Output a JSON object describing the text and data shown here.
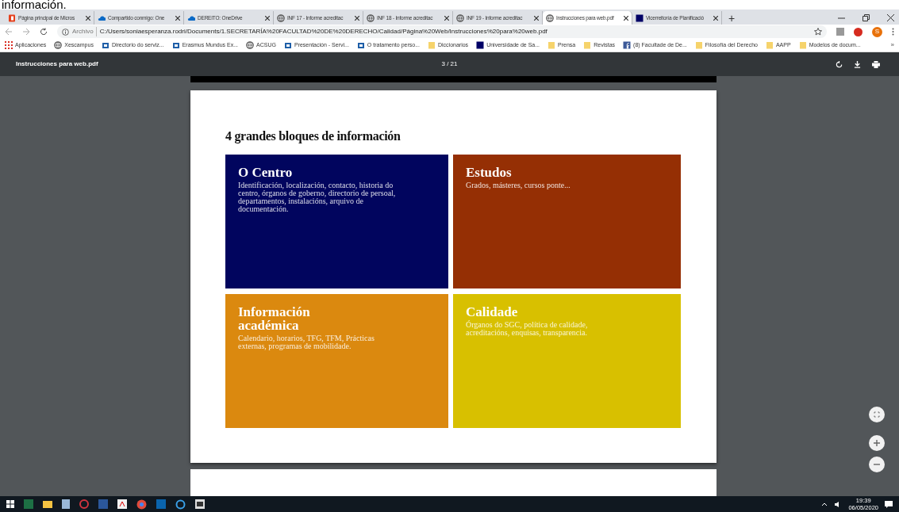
{
  "caption": "información.",
  "tabs": [
    {
      "title": "Página principal de Micros",
      "selected": false
    },
    {
      "title": "Compartido conmigo: One",
      "selected": false
    },
    {
      "title": "DEREITO: OneDrive",
      "selected": false
    },
    {
      "title": "INF 17 - Informe acreditac",
      "selected": false
    },
    {
      "title": "INF 18 - Informe acreditac",
      "selected": false
    },
    {
      "title": "INF 19 - Informe acreditac",
      "selected": false
    },
    {
      "title": "Instrucciones para web.pdf",
      "selected": true
    },
    {
      "title": "Vicerreitoría de Planificació",
      "selected": false
    }
  ],
  "new_tab": "+",
  "address": {
    "scheme": "Archivo",
    "url": "C:/Users/soniaesperanza.rodri/Documents/1.SECRETARÍA%20FACULTAD%20DE%20DERECHO/Calidad/Página%20Web/Instrucciones%20para%20web.pdf",
    "profile_initial": "S"
  },
  "bookmarks": [
    {
      "label": "Aplicaciones"
    },
    {
      "label": "Xescampus"
    },
    {
      "label": "Directorio do serviz..."
    },
    {
      "label": "Erasmus Mundus Ex..."
    },
    {
      "label": "ACSUG"
    },
    {
      "label": "Presentación - Servi..."
    },
    {
      "label": "O tratamento perso..."
    },
    {
      "label": "Diccionarios"
    },
    {
      "label": "Universidade de Sa..."
    },
    {
      "label": "Prensa"
    },
    {
      "label": "Revistas"
    },
    {
      "label": "(8) Facultade de De..."
    },
    {
      "label": "Filosofía del Derecho"
    },
    {
      "label": "AAPP"
    },
    {
      "label": "Modelos de docum..."
    }
  ],
  "bookmarks_more": "»",
  "pdf": {
    "filename": "Instrucciones para web.pdf",
    "page_indicator": "3 / 21",
    "heading": "4 grandes bloques de información",
    "blocks": [
      {
        "title": "O Centro",
        "text": "Identificación, localización, contacto, historia do centro, órganos de goberno, directorio de persoal, departamentos, instalacións, arquivo de documentación.",
        "color": "#01055e"
      },
      {
        "title": "Estudos",
        "text": "Grados, másteres, cursos ponte...",
        "color": "#952f04"
      },
      {
        "title": "Información académica",
        "text": "Calendario, horarios, TFG, TFM, Prácticas externas, programas de mobilidade.",
        "color": "#db890f"
      },
      {
        "title": "Calidade",
        "text": "Órganos do SGC, política de calidade, acreditacións, enquisas, transparencia.",
        "color": "#d8c000"
      }
    ]
  },
  "taskbar": {
    "time": "19:39",
    "date": "06/05/2020"
  }
}
